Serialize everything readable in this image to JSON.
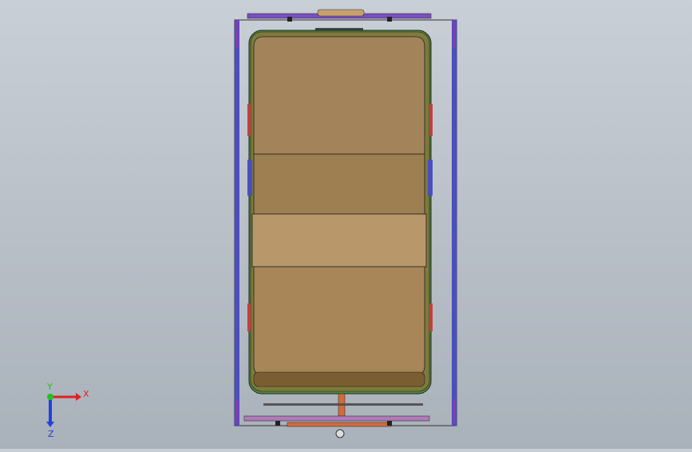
{
  "viewport": {
    "background_top": "#c9cfd6",
    "background_bottom": "#a9b1ba",
    "model": {
      "frame_color": "#3b3fb0",
      "frame_accent": "#7a4fc0",
      "mattress_color": "#a88658",
      "mattress_light": "#b8976a",
      "mattress_dark": "#8f6e40",
      "rail_color": "#3a7d2f",
      "bottom_bar_color": "#d46a3a",
      "outline_color": "#222222"
    }
  },
  "triad": {
    "x_label": "X",
    "y_label": "Y",
    "z_label": "Z",
    "x_color": "#e02020",
    "y_color": "#20c020",
    "z_color": "#2040e0"
  }
}
